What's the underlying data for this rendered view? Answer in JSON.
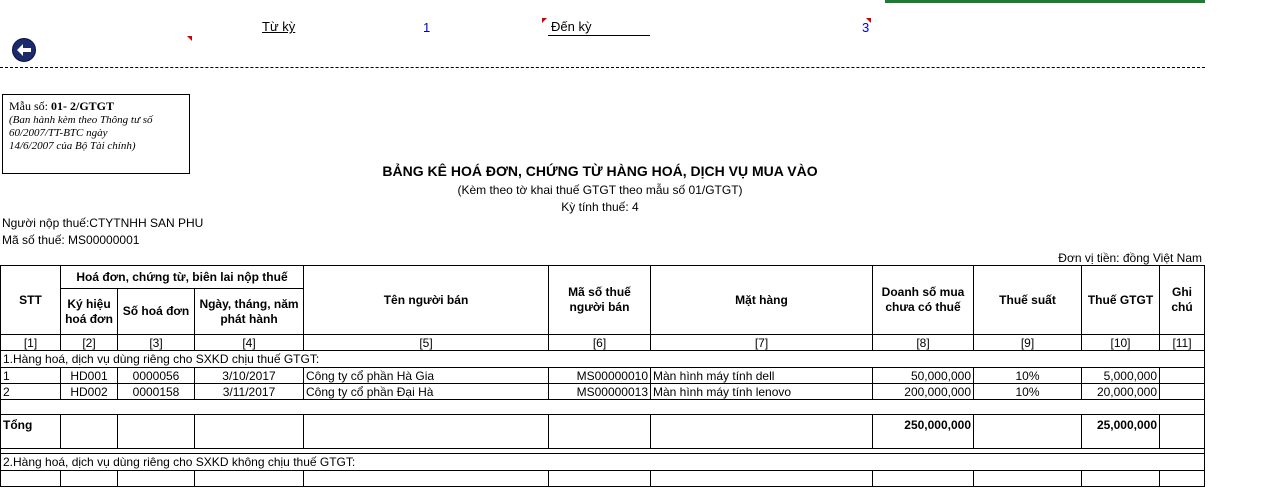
{
  "header": {
    "tu_ky_label": "Từ kỳ",
    "tu_ky_value": "1",
    "den_ky_label": "Đến kỳ",
    "den_ky_value": "3"
  },
  "form": {
    "code_label": "Mẫu số:",
    "code_value": "01- 2/GTGT",
    "note_1": "(Ban hành kèm theo Thông tư số",
    "note_2": "60/2007/TT-BTC ngày",
    "note_3": "14/6/2007 của  Bộ Tài chính)"
  },
  "title": "BẢNG KÊ HOÁ ĐƠN, CHỨNG TỪ HÀNG HOÁ, DỊCH VỤ MUA VÀO",
  "subtitle": "(Kèm theo tờ khai thuế GTGT theo mẫu số 01/GTGT)",
  "period": "Kỳ tính thuế: 4",
  "taxpayer": "Người nộp thuế:CTYTNHH SAN PHU",
  "tax_code": "Mã số thuế: MS00000001",
  "unit": "Đơn vị tiền: đồng Việt Nam",
  "table": {
    "headers": {
      "stt": "STT",
      "invoice_group": "Hoá đơn, chứng từ, biên lai nộp thuế",
      "ky_hieu": "Ký hiệu hoá đơn",
      "so_hoa_don": "Số hoá đơn",
      "ngay": "Ngày, tháng, năm phát hành",
      "ten_nguoi_ban": "Tên người bán",
      "ma_so_thue": "Mã số thuế người bán",
      "mat_hang": "Mặt hàng",
      "doanh_so": "Doanh số mua chưa có thuế",
      "thue_suat": "Thuế suất",
      "thue_gtgt": "Thuế GTGT",
      "ghi_chu": "Ghi chú"
    },
    "col_numbers": [
      "[1]",
      "[2]",
      "[3]",
      "[4]",
      "[5]",
      "[6]",
      "[7]",
      "[8]",
      "[9]",
      "[10]",
      "[11]"
    ],
    "section1": "1.Hàng hoá, dịch vụ dùng riêng cho SXKD chịu thuế GTGT:",
    "rows": [
      {
        "stt": "1",
        "ky_hieu": "HD001",
        "so": "0000056",
        "ngay": "3/10/2017",
        "nguoi_ban": "Công ty cổ phần Hà Gia",
        "mst": "MS00000010",
        "mat_hang": "Màn hình máy tính dell",
        "doanh_so": "50,000,000",
        "thue_suat": "10%",
        "thue": "5,000,000",
        "ghi_chu": ""
      },
      {
        "stt": "2",
        "ky_hieu": "HD002",
        "so": "0000158",
        "ngay": "3/11/2017",
        "nguoi_ban": "Công ty cổ phần Đại Hà",
        "mst": "MS00000013",
        "mat_hang": "Màn hình máy tính lenovo",
        "doanh_so": "200,000,000",
        "thue_suat": "10%",
        "thue": "20,000,000",
        "ghi_chu": ""
      }
    ],
    "total_label": "Tổng",
    "total_doanh_so": "250,000,000",
    "total_thue": "25,000,000",
    "section2": "2.Hàng hoá, dịch vụ dùng riêng cho SXKD không chịu thuế GTGT:"
  }
}
